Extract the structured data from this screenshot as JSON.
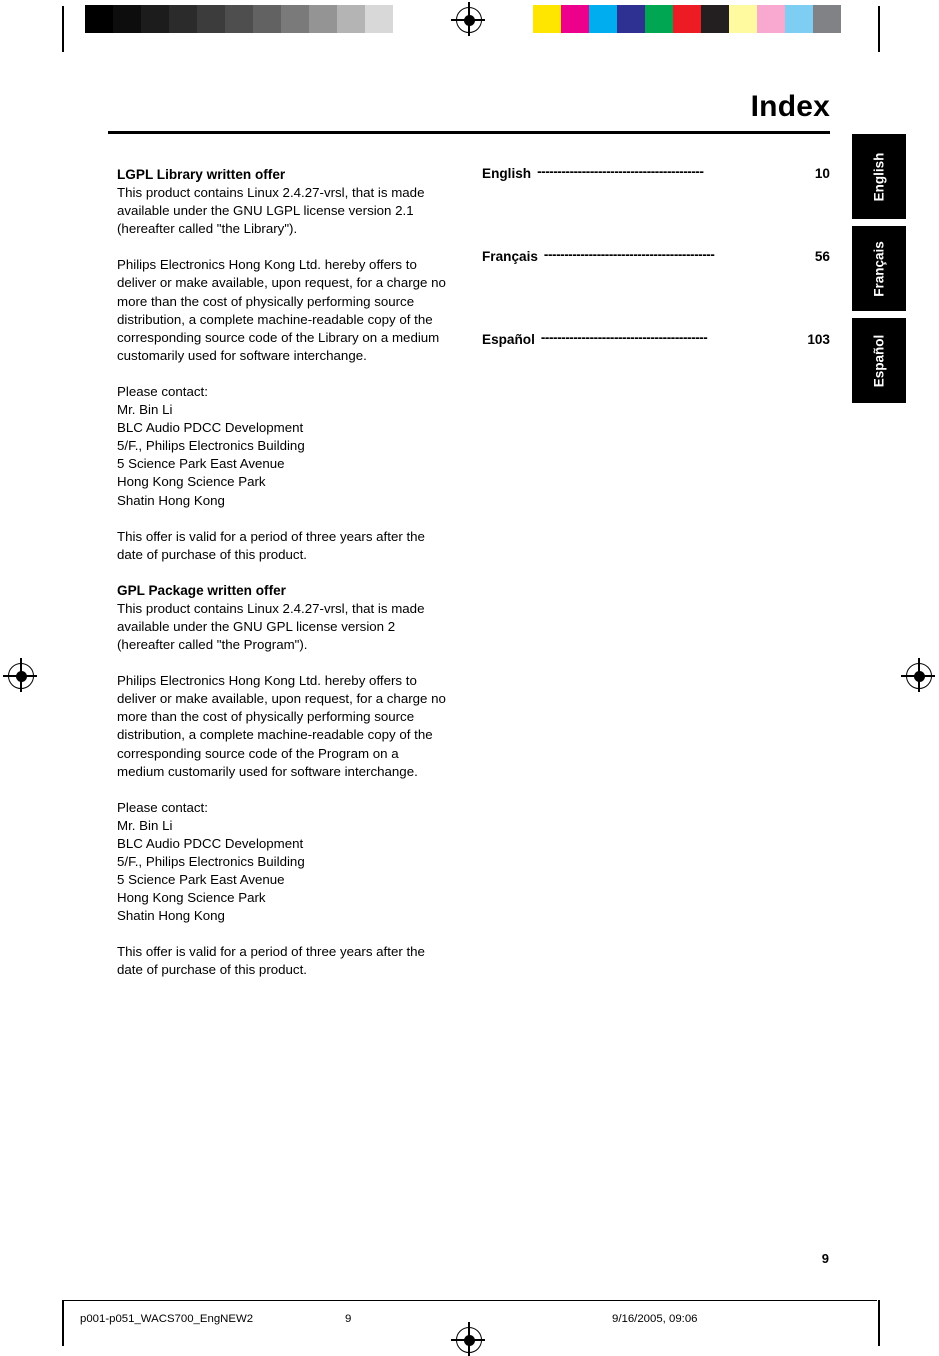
{
  "document": {
    "title": "Index",
    "page_number": "9"
  },
  "left_column": {
    "blocks": [
      {
        "type": "heading",
        "text": "LGPL Library written offer"
      },
      {
        "type": "para",
        "text": "This product contains Linux 2.4.27-vrsl, that is made available under the GNU LGPL license version 2.1 (hereafter called \"the Library\")."
      },
      {
        "type": "gap"
      },
      {
        "type": "para",
        "text": "Philips Electronics Hong Kong Ltd. hereby offers to deliver or make available, upon request, for a charge no more than the cost of physically performing source distribution, a complete machine-readable copy of the corresponding source code of the Library on a medium customarily used for software interchange."
      },
      {
        "type": "gap"
      },
      {
        "type": "para",
        "text": "Please contact:"
      },
      {
        "type": "para",
        "text": "Mr. Bin Li"
      },
      {
        "type": "para",
        "text": "BLC Audio PDCC Development"
      },
      {
        "type": "para",
        "text": "5/F., Philips Electronics Building"
      },
      {
        "type": "para",
        "text": "5 Science Park East Avenue"
      },
      {
        "type": "para",
        "text": "Hong Kong Science Park"
      },
      {
        "type": "para",
        "text": "Shatin Hong Kong"
      },
      {
        "type": "gap"
      },
      {
        "type": "para",
        "text": "This offer is valid for a period of three years after the date of purchase of this product."
      },
      {
        "type": "gap"
      },
      {
        "type": "heading",
        "text": "GPL Package written offer"
      },
      {
        "type": "para",
        "text": "This product contains Linux 2.4.27-vrsl, that is made available under the GNU GPL license version 2 (hereafter called \"the Program\")."
      },
      {
        "type": "gap"
      },
      {
        "type": "para",
        "text": "Philips Electronics Hong Kong Ltd. hereby offers to deliver or make available, upon request, for a charge no more than the cost of physically performing source distribution, a complete machine-readable copy of the corresponding source code of the Program on a medium customarily used for software interchange."
      },
      {
        "type": "gap"
      },
      {
        "type": "para",
        "text": "Please contact:"
      },
      {
        "type": "para",
        "text": "Mr. Bin Li"
      },
      {
        "type": "para",
        "text": "BLC Audio PDCC Development"
      },
      {
        "type": "para",
        "text": "5/F., Philips Electronics Building"
      },
      {
        "type": "para",
        "text": "5 Science Park East Avenue"
      },
      {
        "type": "para",
        "text": "Hong Kong Science Park"
      },
      {
        "type": "para",
        "text": "Shatin Hong Kong"
      },
      {
        "type": "gap"
      },
      {
        "type": "para",
        "text": "This offer is valid for a period of three years after the date of purchase of this product."
      }
    ]
  },
  "index_entries": [
    {
      "language": "English",
      "dots": "-----------------------------------------",
      "page": "10"
    },
    {
      "language": "Français",
      "dots": "------------------------------------------",
      "page": "56"
    },
    {
      "language": "Español",
      "dots": "-----------------------------------------",
      "page": "103"
    }
  ],
  "language_tabs": [
    {
      "label": "English"
    },
    {
      "label": "Français"
    },
    {
      "label": "Español"
    }
  ],
  "footer": {
    "file": "p001-p051_WACS700_EngNEW2",
    "page": "9",
    "date": "9/16/2005, 09:06"
  },
  "print_marks": {
    "grayscale_swatches": [
      "#000000",
      "#0d0d0d",
      "#1c1c1c",
      "#2b2b2b",
      "#3c3c3c",
      "#4e4e4e",
      "#626262",
      "#7a7a7a",
      "#949494",
      "#b4b4b4",
      "#d8d8d8",
      "#ffffff"
    ],
    "color_swatches": [
      "#ffe600",
      "#ec008c",
      "#00aeef",
      "#2e3192",
      "#00a651",
      "#ed1c24",
      "#231f20",
      "#fff9a0",
      "#f9a8cf",
      "#7ecef4",
      "#808285"
    ]
  }
}
